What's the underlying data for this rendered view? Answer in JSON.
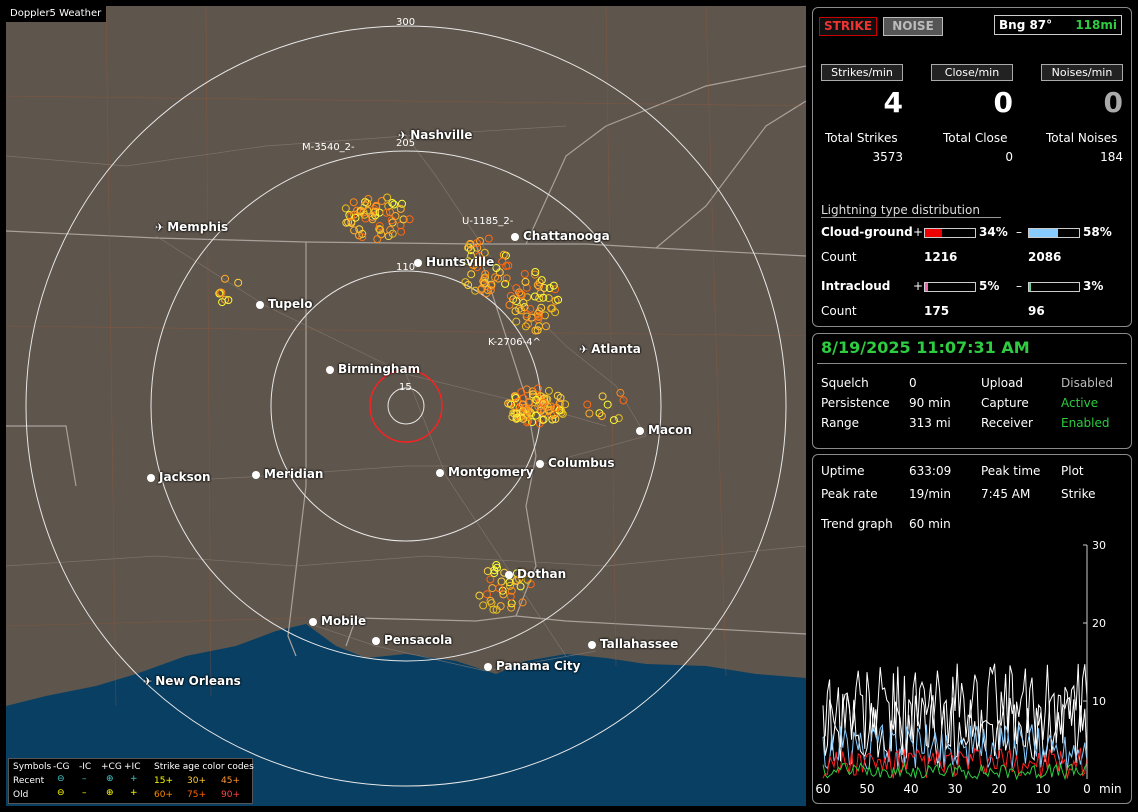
{
  "app_title": "Doppler5 Weather",
  "map": {
    "range_labels": [
      "300",
      "205",
      "110",
      "15"
    ],
    "cities": [
      {
        "name": "Nashville",
        "icon": "airport-icon"
      },
      {
        "name": "Memphis",
        "icon": "airport-icon"
      },
      {
        "name": "Chattanooga",
        "icon": "city-dot-icon"
      },
      {
        "name": "Huntsville",
        "icon": "city-dot-icon"
      },
      {
        "name": "Tupelo",
        "icon": "city-dot-icon"
      },
      {
        "name": "Atlanta",
        "icon": "airport-icon"
      },
      {
        "name": "Birmingham",
        "icon": "city-dot-icon"
      },
      {
        "name": "Macon",
        "icon": "city-dot-icon"
      },
      {
        "name": "Jackson",
        "icon": "city-dot-icon"
      },
      {
        "name": "Meridian",
        "icon": "city-dot-icon"
      },
      {
        "name": "Montgomery",
        "icon": "city-dot-icon"
      },
      {
        "name": "Columbus",
        "icon": "city-dot-icon"
      },
      {
        "name": "Dothan",
        "icon": "city-dot-icon"
      },
      {
        "name": "Mobile",
        "icon": "city-dot-icon"
      },
      {
        "name": "Pensacola",
        "icon": "city-dot-icon"
      },
      {
        "name": "Tallahassee",
        "icon": "city-dot-icon"
      },
      {
        "name": "Panama City",
        "icon": "city-dot-icon"
      },
      {
        "name": "New Orleans",
        "icon": "airport-icon"
      }
    ],
    "station_labels": [
      "M-3540_2-",
      "U-1185_2-",
      "K-2706-4^"
    ],
    "legend": {
      "symbols_label": "Symbols",
      "cols": [
        "-CG",
        "-IC",
        "+CG",
        "+IC"
      ],
      "recent_label": "Recent",
      "old_label": "Old",
      "age_title": "Strike age color codes",
      "ages": [
        "15+",
        "30+",
        "45+",
        "60+",
        "75+",
        "90+"
      ]
    }
  },
  "status": {
    "strike_button": "STRIKE",
    "noise_button": "NOISE",
    "bearing": "Bng 87°",
    "distance": "118mi",
    "headers": [
      "Strikes/min",
      "Close/min",
      "Noises/min"
    ],
    "rates": [
      "4",
      "0",
      "0"
    ],
    "totals_labels": [
      "Total Strikes",
      "Total Close",
      "Total Noises"
    ],
    "totals": [
      "3573",
      "0",
      "184"
    ],
    "dist_title": "Lightning type distribution",
    "cg_label": "Cloud-ground",
    "ic_label": "Intracloud",
    "count_label": "Count",
    "cg_pos_pct": "34%",
    "cg_neg_pct": "58%",
    "cg_pos_count": "1216",
    "cg_neg_count": "2086",
    "ic_pos_pct": "5%",
    "ic_neg_pct": "3%",
    "ic_pos_count": "175",
    "ic_neg_count": "96",
    "cg_pos_frac": 0.34,
    "cg_neg_frac": 0.58,
    "ic_pos_frac": 0.05,
    "ic_neg_frac": 0.03
  },
  "settings": {
    "datetime": "8/19/2025 11:07:31 AM",
    "squelch_label": "Squelch",
    "squelch": "0",
    "persistence_label": "Persistence",
    "persistence": "90 min",
    "range_label": "Range",
    "range": "313 mi",
    "upload_label": "Upload",
    "upload": "Disabled",
    "capture_label": "Capture",
    "capture": "Active",
    "receiver_label": "Receiver",
    "receiver": "Enabled"
  },
  "stats": {
    "uptime_label": "Uptime",
    "uptime": "633:09",
    "peak_time_label": "Peak time",
    "peak_time": "7:45 AM",
    "plot_label": "Plot",
    "plot": "Strike",
    "peak_rate_label": "Peak rate",
    "peak_rate": "19/min",
    "trend_label": "Trend graph",
    "trend": "60 min"
  },
  "chart_data": {
    "type": "line",
    "x_ticks": [
      "60",
      "50",
      "40",
      "30",
      "20",
      "10",
      "0"
    ],
    "x_unit": "min",
    "y_ticks": [
      "30",
      "20",
      "10"
    ],
    "ylim": [
      0,
      30
    ],
    "xlim": [
      60,
      0
    ]
  }
}
